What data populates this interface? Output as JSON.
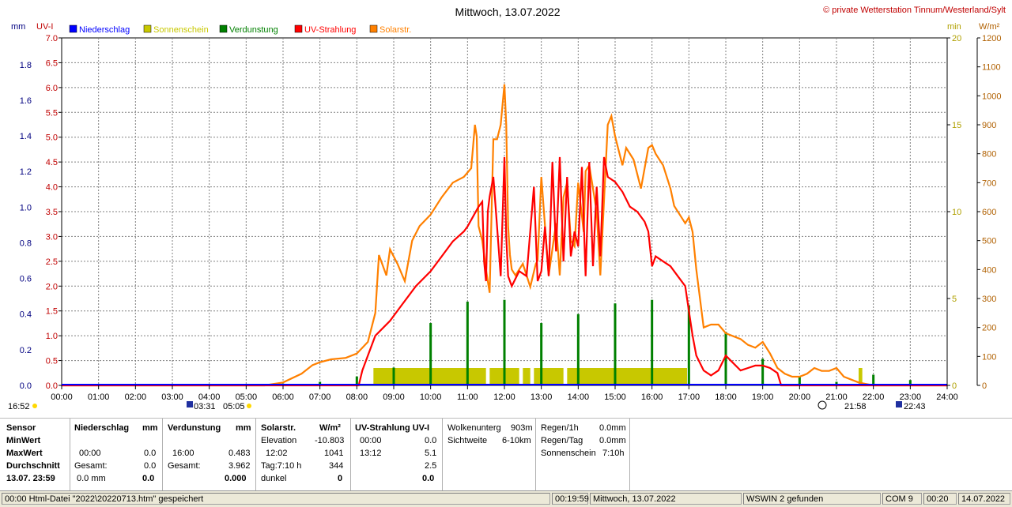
{
  "chart_data": {
    "type": "line",
    "title": "Mittwoch, 13.07.2022",
    "copyright": "© private Wetterstation Tinnum/Westerland/Sylt",
    "axes": {
      "left_outer": {
        "unit": "mm",
        "ticks": [
          "0.0",
          "0.2",
          "0.4",
          "0.6",
          "0.8",
          "1.0",
          "1.2",
          "1.4",
          "1.6",
          "1.8"
        ],
        "ylim": [
          0,
          1.95
        ]
      },
      "left_inner": {
        "unit": "UV-I",
        "ticks": [
          "0.0",
          "0.5",
          "1.0",
          "1.5",
          "2.0",
          "2.5",
          "3.0",
          "3.5",
          "4.0",
          "4.5",
          "5.0",
          "5.5",
          "6.0",
          "6.5",
          "7.0"
        ],
        "ylim": [
          0,
          7
        ]
      },
      "right_inner": {
        "unit": "min",
        "ticks": [
          "0",
          "5",
          "10",
          "15",
          "20"
        ],
        "ylim": [
          0,
          20
        ]
      },
      "right_outer": {
        "unit": "W/m²",
        "ticks": [
          "0",
          "100",
          "200",
          "300",
          "400",
          "500",
          "600",
          "700",
          "800",
          "900",
          "1000",
          "1100",
          "1200"
        ],
        "ylim": [
          0,
          1200
        ]
      },
      "x": {
        "ticks": [
          "00:00",
          "01:00",
          "02:00",
          "03:00",
          "04:00",
          "05:00",
          "06:00",
          "07:00",
          "08:00",
          "09:00",
          "10:00",
          "11:00",
          "12:00",
          "13:00",
          "14:00",
          "15:00",
          "16:00",
          "17:00",
          "18:00",
          "19:00",
          "20:00",
          "21:00",
          "22:00",
          "23:00",
          "24:00"
        ],
        "xlim": [
          0,
          24
        ]
      }
    },
    "legend": [
      {
        "name": "Niederschlag",
        "color": "#0000ff"
      },
      {
        "name": "Sonnenschein",
        "color": "#c8c800"
      },
      {
        "name": "Verdunstung",
        "color": "#008000"
      },
      {
        "name": "UV-Strahlung",
        "color": "#ff0000"
      },
      {
        "name": "Solarstr.",
        "color": "#ff8000"
      }
    ],
    "grid": true,
    "series": [
      {
        "name": "Solarstr.",
        "color": "#ff8000",
        "axis": "right_outer",
        "x": [
          0,
          5.5,
          6,
          6.5,
          6.8,
          7,
          7.3,
          7.7,
          8,
          8.3,
          8.5,
          8.6,
          8.8,
          8.9,
          9.1,
          9.3,
          9.5,
          9.7,
          10,
          10.3,
          10.6,
          10.9,
          11.1,
          11.2,
          11.25,
          11.3,
          11.4,
          11.5,
          11.6,
          11.7,
          11.8,
          11.9,
          12,
          12.05,
          12.1,
          12.15,
          12.2,
          12.3,
          12.5,
          12.7,
          12.85,
          12.9,
          13.0,
          13.2,
          13.4,
          13.5,
          13.6,
          13.7,
          13.8,
          13.9,
          14.0,
          14.15,
          14.2,
          14.3,
          14.5,
          14.6,
          14.8,
          14.9,
          15.0,
          15.2,
          15.3,
          15.5,
          15.7,
          15.9,
          16.0,
          16.1,
          16.3,
          16.5,
          16.6,
          16.8,
          16.9,
          17.0,
          17.1,
          17.2,
          17.4,
          17.6,
          17.8,
          18.0,
          18.2,
          18.4,
          18.6,
          18.8,
          19.0,
          19.2,
          19.4,
          19.6,
          19.8,
          20.0,
          20.2,
          20.4,
          20.6,
          20.8,
          21.0,
          21.2,
          21.4,
          21.6,
          21.8,
          22.0,
          24
        ],
        "values": [
          0,
          0,
          10,
          40,
          70,
          80,
          90,
          95,
          110,
          150,
          250,
          450,
          380,
          470,
          420,
          360,
          500,
          550,
          590,
          650,
          700,
          720,
          750,
          900,
          860,
          550,
          500,
          400,
          320,
          850,
          850,
          900,
          1040,
          900,
          550,
          450,
          400,
          380,
          420,
          340,
          420,
          430,
          720,
          380,
          560,
          380,
          650,
          700,
          500,
          480,
          700,
          530,
          740,
          760,
          600,
          380,
          900,
          930,
          860,
          760,
          820,
          780,
          680,
          820,
          830,
          800,
          760,
          680,
          620,
          580,
          560,
          580,
          530,
          400,
          200,
          210,
          210,
          180,
          170,
          160,
          140,
          130,
          150,
          110,
          60,
          40,
          30,
          30,
          40,
          60,
          50,
          50,
          60,
          30,
          20,
          10,
          5,
          0,
          0
        ]
      },
      {
        "name": "UV-Strahlung",
        "color": "#ff0000",
        "axis": "left_inner",
        "x": [
          0,
          8.05,
          8.15,
          8.3,
          8.5,
          8.7,
          8.9,
          9.2,
          9.6,
          10,
          10.3,
          10.6,
          10.9,
          11.0,
          11.15,
          11.3,
          11.4,
          11.45,
          11.5,
          11.55,
          11.6,
          11.7,
          11.8,
          11.9,
          12.0,
          12.05,
          12.1,
          12.2,
          12.4,
          12.6,
          12.8,
          12.9,
          13.0,
          13.1,
          13.2,
          13.3,
          13.4,
          13.5,
          13.6,
          13.7,
          13.8,
          13.9,
          14.0,
          14.1,
          14.2,
          14.3,
          14.4,
          14.5,
          14.6,
          14.7,
          14.8,
          15.0,
          15.2,
          15.4,
          15.6,
          15.8,
          15.9,
          16.0,
          16.1,
          16.3,
          16.5,
          16.7,
          16.9,
          17.0,
          17.1,
          17.2,
          17.4,
          17.6,
          17.8,
          18.0,
          18.2,
          18.4,
          18.6,
          18.8,
          19.0,
          19.2,
          19.4,
          19.5,
          24
        ],
        "values": [
          0,
          0,
          0.3,
          0.6,
          1.0,
          1.15,
          1.3,
          1.6,
          2.0,
          2.3,
          2.6,
          2.9,
          3.1,
          3.2,
          3.4,
          3.6,
          3.7,
          2.5,
          2.1,
          3.5,
          3.8,
          4.2,
          3.2,
          2.2,
          4.6,
          3.0,
          2.2,
          2.0,
          2.3,
          2.2,
          4.0,
          2.1,
          2.3,
          3.2,
          2.2,
          4.5,
          2.7,
          4.6,
          2.5,
          4.2,
          2.6,
          3.1,
          2.8,
          4.4,
          2.2,
          4.5,
          2.4,
          4.0,
          2.6,
          4.6,
          4.2,
          4.1,
          3.9,
          3.6,
          3.5,
          3.3,
          3.1,
          2.4,
          2.6,
          2.5,
          2.4,
          2.2,
          2.0,
          1.5,
          1.0,
          0.6,
          0.3,
          0.2,
          0.3,
          0.6,
          0.45,
          0.3,
          0.35,
          0.4,
          0.4,
          0.35,
          0.25,
          0,
          0
        ]
      },
      {
        "name": "Verdunstung",
        "color": "#008000",
        "axis": "left_outer",
        "x": [
          1,
          2,
          3,
          4,
          5,
          6,
          7,
          8,
          9,
          10,
          11,
          12,
          13,
          14,
          15,
          16,
          17,
          18,
          19,
          20,
          21,
          22,
          23
        ],
        "values": [
          0.005,
          0.005,
          0.005,
          0.005,
          0.005,
          0.01,
          0.02,
          0.05,
          0.1,
          0.35,
          0.47,
          0.48,
          0.35,
          0.4,
          0.46,
          0.48,
          0.45,
          0.3,
          0.15,
          0.05,
          0.02,
          0.06,
          0.03
        ]
      },
      {
        "name": "Sonnenschein",
        "color": "#c8c800",
        "axis": "right_inner",
        "blocks": [
          [
            8.45,
            11.5
          ],
          [
            11.6,
            12.4
          ],
          [
            12.5,
            12.7
          ],
          [
            12.8,
            13.6
          ],
          [
            13.7,
            16.95
          ],
          [
            21.6,
            21.7
          ]
        ],
        "level": 1
      }
    ]
  },
  "markers": {
    "sunrise_time": "03:31",
    "sunset_time": "05:05",
    "moon_set": "21:58",
    "moon_rise": "22:43",
    "left_time": "16:52"
  },
  "stats": {
    "sensor": {
      "header": "Sensor",
      "min": "MinWert",
      "max": "MaxWert",
      "avg": "Durchschnitt",
      "date": "13.07. 23:59"
    },
    "niederschlag": {
      "header": "Niederschlag",
      "unit": "mm",
      "max_time": "00:00",
      "max_val": "0.0",
      "gesamt_label": "Gesamt:",
      "gesamt_val": "0.0",
      "avg_val": "0.0 mm",
      "avg_total": "0.0"
    },
    "verdunstung": {
      "header": "Verdunstung",
      "unit": "mm",
      "max_time": "16:00",
      "max_val": "0.483",
      "gesamt_label": "Gesamt:",
      "gesamt_val": "3.962",
      "avg_total": "0.000"
    },
    "solar": {
      "header": "Solarstr.",
      "unit": "W/m²",
      "elev_label": "Elevation",
      "elev_val": "-10.803",
      "max_time": "12:02",
      "max_val": "1041",
      "tag_label": "Tag:7:10 h",
      "tag_val": "344",
      "dunkel_label": "dunkel",
      "dunkel_val": "0"
    },
    "uv": {
      "header": "UV-Strahlung UV-I",
      "min_time": "00:00",
      "min_val": "0.0",
      "max_time": "13:12",
      "max_val": "5.1",
      "avg_val": "2.5",
      "total": "0.0"
    },
    "wolken": {
      "label1": "Wolkenunterg",
      "val1": "903m",
      "label2": "Sichtweite",
      "val2": "6-10km"
    },
    "regen": {
      "label1": "Regen/1h",
      "val1": "0.0mm",
      "label2": "Regen/Tag",
      "val2": "0.0mm",
      "label3": "Sonnenschein",
      "val3": "7:10h"
    }
  },
  "statusbar": {
    "left": "00:00  Html-Datei  \"2022\\20220713.htm\"  gespeichert",
    "time": "00:19:59",
    "date": "Mittwoch, 13.07.2022",
    "wswin": "WSWIN 2 gefunden",
    "com": "COM 9",
    "t2": "00:20",
    "d2": "14.07.2022"
  }
}
